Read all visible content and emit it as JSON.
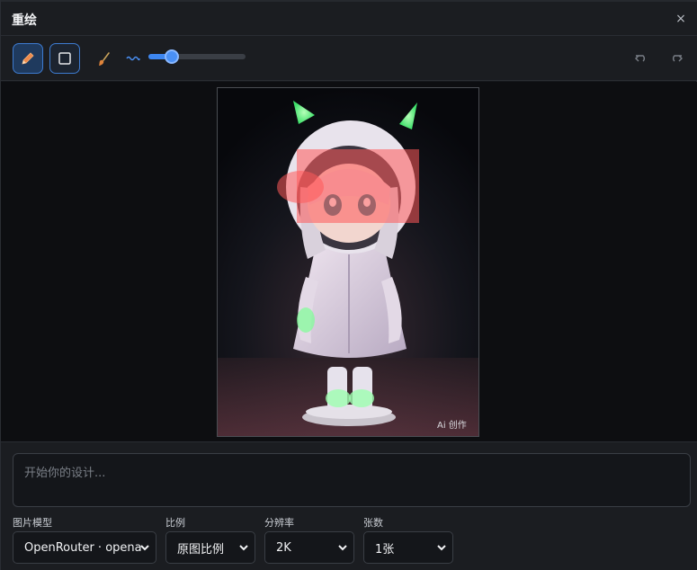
{
  "dialog": {
    "title": "重绘",
    "close_label": "×"
  },
  "toolbar": {
    "tools": [
      {
        "name": "pencil-icon",
        "active": true
      },
      {
        "name": "rectangle-icon",
        "active": false
      },
      {
        "name": "brush-icon"
      },
      {
        "name": "wave-icon"
      }
    ],
    "brush_size": 0.2,
    "undo_icon": "undo-icon",
    "redo_icon": "redo-icon"
  },
  "canvas": {
    "watermark": "Ai 创作"
  },
  "prompt": {
    "placeholder": "开始你的设计..."
  },
  "fields": {
    "model": {
      "label": "图片模型",
      "value": "OpenRouter · opena"
    },
    "ratio": {
      "label": "比例",
      "value": "原图比例"
    },
    "resolution": {
      "label": "分辨率",
      "value": "2K"
    },
    "count": {
      "label": "张数",
      "value": "1张"
    }
  },
  "colors": {
    "accent": "#3d86f0",
    "mask": "#ff5a5a",
    "glow": "#4cff7a"
  }
}
